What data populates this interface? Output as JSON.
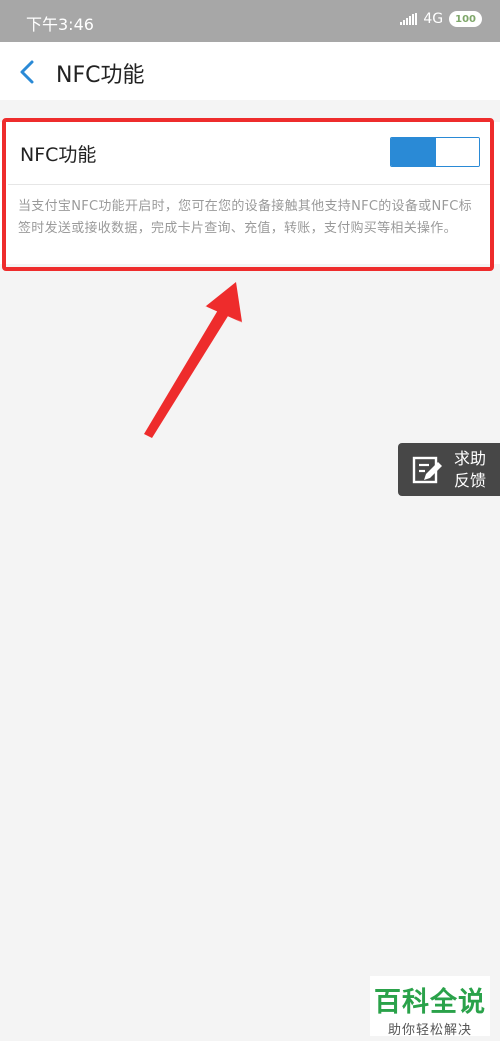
{
  "status_bar": {
    "time": "下午3:46",
    "network": "4G",
    "battery": "100"
  },
  "nav": {
    "back_icon": "chevron-left-icon",
    "title": "NFC功能"
  },
  "nfc_setting": {
    "label": "NFC功能",
    "toggle_on": true,
    "description": "当支付宝NFC功能开启时，您可在您的设备接触其他支持NFC的设备或NFC标签时发送或接收数据，完成卡片查询、充值，转账，支付购买等相关操作。"
  },
  "annotation": {
    "highlight_color": "#ee2c2c",
    "arrow_color": "#ee2c2c"
  },
  "feedback": {
    "icon": "edit-note-icon",
    "line1": "求助",
    "line2": "反馈"
  },
  "watermark": {
    "logo": "百科全说",
    "slogan": "助你轻松解决"
  },
  "colors": {
    "accent": "#2a8ad6",
    "status_bar": "#a7a7a7",
    "watermark_green": "#2aa24a"
  }
}
